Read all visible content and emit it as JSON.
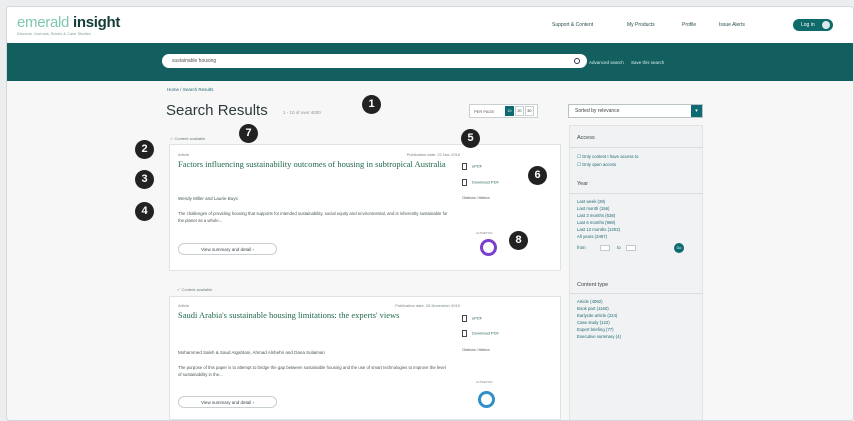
{
  "brand": {
    "light": "emerald",
    "bold": "insight",
    "tagline": "Discover Journals, Books & Case Studies"
  },
  "topnav": {
    "items": [
      "Support & Content",
      "My Products",
      "Profile",
      "Issue Alerts"
    ],
    "login": "Log in"
  },
  "search": {
    "value": "sustainable housing",
    "advanced": "Advanced search",
    "save": "Save this search"
  },
  "breadcrumb": {
    "home": "Home",
    "separator": "/",
    "current": "Search Results"
  },
  "results": {
    "title": "Search Results",
    "count": "1 - 10 of over 4000",
    "per_page_label": "PER PAGE",
    "per_page_options": [
      "10",
      "20",
      "50"
    ],
    "sort": "Sorted by relevance",
    "items": [
      {
        "access": "Content available",
        "type": "Article",
        "date": "Publication date: 22 Nov 2016",
        "title": "Factors influencing sustainability outcomes of housing in subtropical Australia",
        "authors": "Wendy Miller and Laurie Buys",
        "abstract": "The challenges of providing housing that supports for intended sustainability, social equity and environmental, and is inherently sustainable for the planet as a whole...",
        "view_button": "View summary and detail",
        "files": [
          "ePDF",
          "Download PDF"
        ],
        "metrics": "Citations / Metrics",
        "altmetric": "ALTMETRIC"
      },
      {
        "access": "Content available",
        "type": "Article",
        "date": "Publication date: 28 November 2019",
        "title": "Saudi Arabia's sustainable housing limitations: the experts' views",
        "authors": "Mohammed Saleh & Saud Algahtani, Ahmad Alshehri and Dana Sulaiman",
        "abstract": "The purpose of this paper is to attempt to bridge the gap between sustainable housing and the use of smart technologies to improve the level of sustainability in the...",
        "view_button": "View summary and detail",
        "files": [
          "ePDF",
          "Download PDF"
        ],
        "metrics": "Citations / Metrics",
        "altmetric": "ALTMETRIC"
      }
    ]
  },
  "filters": {
    "access_heading": "Access",
    "access_options": [
      "Only content I have access to",
      "Only open access"
    ],
    "year_heading": "Year",
    "year_options": [
      "Last week (28)",
      "Last month (156)",
      "Last 3 months (538)",
      "Last 6 months (968)",
      "Last 12 months (1203)",
      "All years (3467)"
    ],
    "year_from": "from",
    "year_to": "to",
    "year_go": "Go",
    "type_heading": "Content type",
    "type_options": [
      "Article (4092)",
      "Book part (1160)",
      "Earlycite article (224)",
      "Case study (122)",
      "Expert briefing (77)",
      "Executive summary (4)"
    ]
  },
  "markers": [
    "1",
    "2",
    "3",
    "4",
    "5",
    "6",
    "7",
    "8"
  ],
  "colors": {
    "brand_teal": "#135f5f",
    "accent": "#0e6a72",
    "marker": "#222222",
    "altmetric_purple": "#7a3fd1",
    "altmetric_blue": "#2f8fc7"
  }
}
